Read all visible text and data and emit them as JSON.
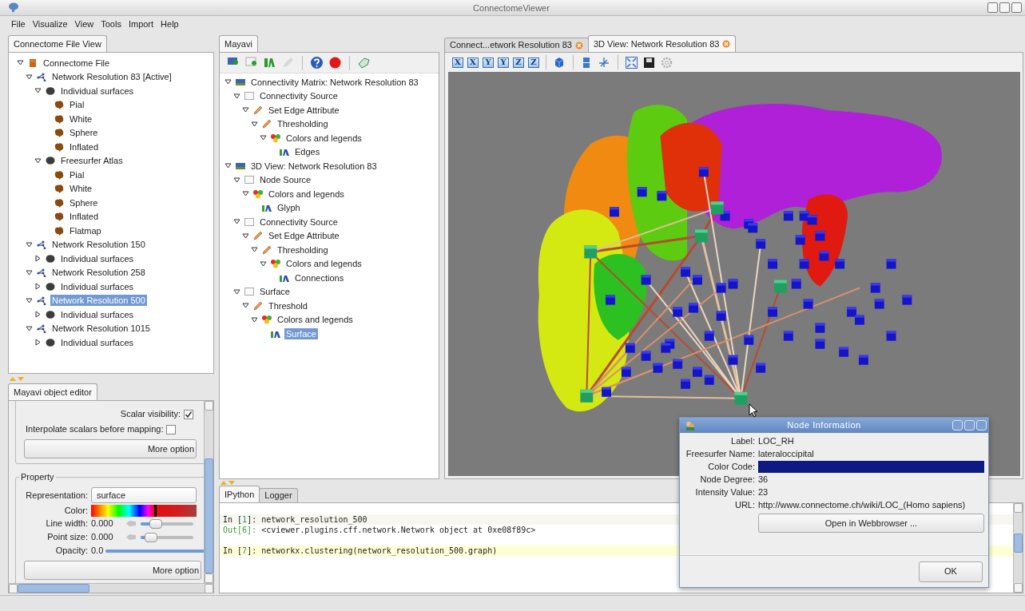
{
  "window": {
    "title": "ConnectomeViewer"
  },
  "menu": [
    "File",
    "Visualize",
    "View",
    "Tools",
    "Import",
    "Help"
  ],
  "file_view": {
    "tab": "Connectome File View",
    "tree": [
      {
        "label": "Connectome File",
        "kind": "file",
        "expanded": true,
        "selected": false,
        "children": [
          {
            "label": "Network Resolution 83 [Active]",
            "kind": "network",
            "expanded": true,
            "selected": false,
            "children": [
              {
                "label": "Individual surfaces",
                "kind": "group",
                "expanded": true,
                "selected": false,
                "children": [
                  {
                    "label": "Pial",
                    "kind": "surface",
                    "selected": false
                  },
                  {
                    "label": "White",
                    "kind": "surface",
                    "selected": false
                  },
                  {
                    "label": "Sphere",
                    "kind": "surface",
                    "selected": false
                  },
                  {
                    "label": "Inflated",
                    "kind": "surface",
                    "selected": false
                  }
                ]
              },
              {
                "label": "Freesurfer Atlas",
                "kind": "group",
                "expanded": true,
                "selected": false,
                "children": [
                  {
                    "label": "Pial",
                    "kind": "surface",
                    "selected": false
                  },
                  {
                    "label": "White",
                    "kind": "surface",
                    "selected": false
                  },
                  {
                    "label": "Sphere",
                    "kind": "surface",
                    "selected": false
                  },
                  {
                    "label": "Inflated",
                    "kind": "surface",
                    "selected": false
                  },
                  {
                    "label": "Flatmap",
                    "kind": "surface",
                    "selected": false
                  }
                ]
              }
            ]
          },
          {
            "label": "Network Resolution 150",
            "kind": "network",
            "expanded": true,
            "selected": false,
            "children": [
              {
                "label": "Individual surfaces",
                "kind": "group",
                "expanded": false,
                "selected": false
              }
            ]
          },
          {
            "label": "Network Resolution 258",
            "kind": "network",
            "expanded": true,
            "selected": false,
            "children": [
              {
                "label": "Individual surfaces",
                "kind": "group",
                "expanded": false,
                "selected": false
              }
            ]
          },
          {
            "label": "Network Resolution 500",
            "kind": "network",
            "expanded": true,
            "selected": true,
            "children": [
              {
                "label": "Individual surfaces",
                "kind": "group",
                "expanded": false,
                "selected": false
              }
            ]
          },
          {
            "label": "Network Resolution 1015",
            "kind": "network",
            "expanded": true,
            "selected": false,
            "children": [
              {
                "label": "Individual surfaces",
                "kind": "group",
                "expanded": false,
                "selected": false
              }
            ]
          }
        ]
      }
    ]
  },
  "object_editor": {
    "tab": "Mayavi object editor",
    "scalar_visibility": {
      "label": "Scalar visibility:",
      "checked": true
    },
    "interpolate": {
      "label": "Interpolate scalars before mapping:",
      "checked": false
    },
    "more_options_1": "More option",
    "property": {
      "title": "Property",
      "representation": {
        "label": "Representation:",
        "value": "surface"
      },
      "color": {
        "label": "Color:"
      },
      "sliders": [
        {
          "kind": "slider",
          "label": "Line width:",
          "reading": "0.000",
          "level": 0.3
        },
        {
          "kind": "slider",
          "label": "Point size:",
          "reading": "0.000",
          "level": 0.2
        },
        {
          "kind": "bar",
          "label": "Opacity:",
          "reading": "0.0",
          "level": 1.0
        }
      ]
    },
    "more_options_2": "More option"
  },
  "mayavi": {
    "tab": "Mayavi",
    "toolbar": [
      {
        "disabled": false
      },
      {
        "disabled": false
      },
      {
        "disabled": false
      },
      {
        "disabled": true
      },
      {
        "disabled": false
      },
      {
        "disabled": false
      },
      {
        "disabled": false
      }
    ],
    "tree": [
      {
        "label": "Connectivity Matrix: Network Resolution 83",
        "kind": "scene",
        "expanded": true,
        "selected": false,
        "children": [
          {
            "label": "Connectivity Source",
            "kind": "source",
            "expanded": true,
            "selected": false,
            "children": [
              {
                "label": "Set Edge Attribute",
                "kind": "filter",
                "expanded": true,
                "selected": false,
                "children": [
                  {
                    "label": "Thresholding",
                    "kind": "filter",
                    "expanded": true,
                    "selected": false,
                    "children": [
                      {
                        "label": "Colors and legends",
                        "kind": "colors",
                        "expanded": true,
                        "selected": false,
                        "children": [
                          {
                            "label": "Edges",
                            "kind": "module",
                            "selected": false
                          }
                        ]
                      }
                    ]
                  }
                ]
              }
            ]
          }
        ]
      },
      {
        "label": "3D View: Network Resolution 83",
        "kind": "scene",
        "expanded": true,
        "selected": false,
        "children": [
          {
            "label": "Node Source",
            "kind": "source",
            "expanded": true,
            "selected": false,
            "children": [
              {
                "label": "Colors and legends",
                "kind": "colors",
                "expanded": true,
                "selected": false,
                "children": [
                  {
                    "label": "Glyph",
                    "kind": "module",
                    "selected": false
                  }
                ]
              }
            ]
          },
          {
            "label": "Connectivity Source",
            "kind": "source",
            "expanded": true,
            "selected": false,
            "children": [
              {
                "label": "Set Edge Attribute",
                "kind": "filter",
                "expanded": true,
                "selected": false,
                "children": [
                  {
                    "label": "Thresholding",
                    "kind": "filter",
                    "expanded": true,
                    "selected": false,
                    "children": [
                      {
                        "label": "Colors and legends",
                        "kind": "colors",
                        "expanded": true,
                        "selected": false,
                        "children": [
                          {
                            "label": "Connections",
                            "kind": "module",
                            "selected": false
                          }
                        ]
                      }
                    ]
                  }
                ]
              }
            ]
          },
          {
            "label": "Surface",
            "kind": "source",
            "expanded": true,
            "selected": false,
            "children": [
              {
                "label": "Threshold",
                "kind": "filter",
                "expanded": true,
                "selected": false,
                "children": [
                  {
                    "label": "Colors and legends",
                    "kind": "colors",
                    "expanded": true,
                    "selected": false,
                    "children": [
                      {
                        "label": "Surface",
                        "kind": "module",
                        "selected": true
                      }
                    ]
                  }
                ]
              }
            ]
          }
        ]
      }
    ]
  },
  "view_tabs": [
    {
      "label": "Connect...etwork Resolution 83",
      "selected": false
    },
    {
      "label": "3D View: Network Resolution 83",
      "selected": true
    }
  ],
  "view_toolbar": {
    "axis_buttons": [
      "X",
      "X",
      "Y",
      "Y",
      "Z",
      "Z"
    ]
  },
  "console": {
    "tabs": [
      {
        "label": "IPython",
        "selected": true
      },
      {
        "label": "Logger",
        "selected": false
      }
    ],
    "lines": [
      {
        "kind": "in",
        "prefix": "In [",
        "number": "1",
        "suffix": "]: ",
        "text": "network_resolution_500",
        "current": false
      },
      {
        "kind": "out",
        "prefix": "Out[",
        "number": "6",
        "suffix": "]: ",
        "text": "<cviewer.plugins.cff.network.Network object at 0xe08f89c>"
      },
      {
        "kind": "blank"
      },
      {
        "kind": "in",
        "prefix": "In [",
        "number": "7",
        "suffix": "]: ",
        "text": "networkx.clustering(network_resolution_500.graph)",
        "current": true
      }
    ]
  },
  "node_dialog": {
    "title": "Node Information",
    "fields": [
      {
        "kind": "text",
        "label": "Label:",
        "value": "LOC_RH"
      },
      {
        "kind": "text",
        "label": "Freesurfer Name:",
        "value": "lateraloccipital"
      },
      {
        "kind": "color",
        "label": "Color Code:",
        "color": "#0d1a82"
      },
      {
        "kind": "text",
        "label": "Node Degree:",
        "value": "36"
      },
      {
        "kind": "text",
        "label": "Intensity Value:",
        "value": "23"
      },
      {
        "kind": "text",
        "label": "URL:",
        "value": "http://www.connectome.ch/wiki/LOC_(Homo sapiens)"
      }
    ],
    "open_button": "Open in Webbrowser ...",
    "ok_button": "OK"
  }
}
